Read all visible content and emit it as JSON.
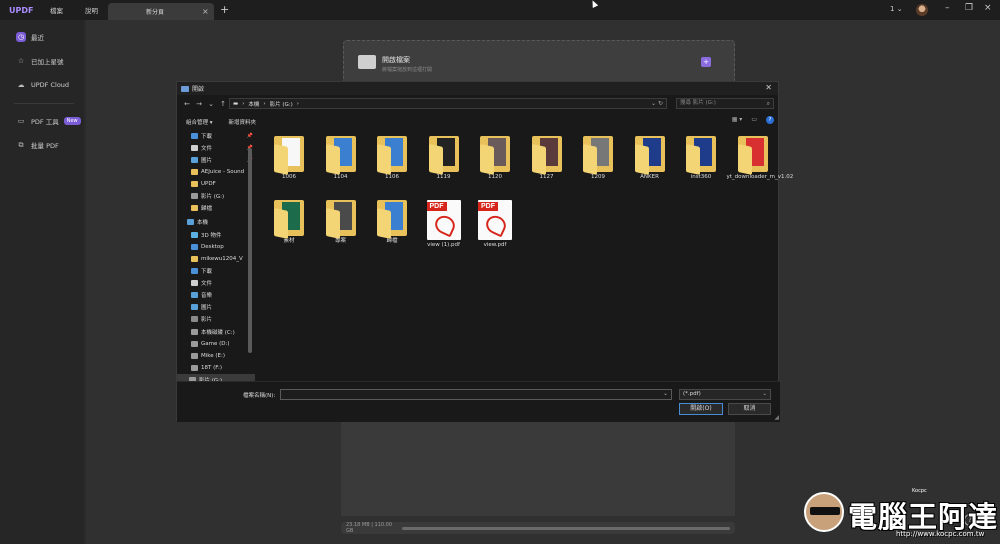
{
  "app": {
    "logo": "UPDF",
    "menu": [
      "檔案",
      "說明"
    ],
    "tab_label": "新分頁",
    "page_selector": "1"
  },
  "sidebar": {
    "items": [
      {
        "label": "最近",
        "icon": "clock-icon"
      },
      {
        "label": "已加上星號",
        "icon": "star-icon"
      },
      {
        "label": "UPDF Cloud",
        "icon": "cloud-icon"
      },
      {
        "label": "PDF 工具",
        "icon": "tools-icon",
        "badge": "New"
      },
      {
        "label": "批量 PDF",
        "icon": "batch-icon"
      }
    ]
  },
  "main": {
    "open_card_title": "開啟檔案",
    "open_card_sub": "將檔案拖放到這裡打開",
    "storage_text": "23.18 MB | 110.00 GB"
  },
  "dialog": {
    "title": "開啟",
    "breadcrumb": [
      "本機",
      "影片 (G:)"
    ],
    "search_placeholder": "搜尋 影片 (G:)",
    "organize": "組合管理",
    "new_folder": "新增資料夾",
    "filename_label": "檔案名稱(N):",
    "filename_value": "",
    "file_type": "(*.pdf)",
    "open_button": "開啟(O)",
    "cancel_button": "取消",
    "tree": [
      {
        "label": "下載",
        "color": "#4a90d9",
        "pin": true
      },
      {
        "label": "文件",
        "color": "#cfcfcf",
        "pin": true
      },
      {
        "label": "圖片",
        "color": "#5aa0d8",
        "pin": true
      },
      {
        "label": "AEJuice - Sound",
        "color": "#e9c15a",
        "pin": false
      },
      {
        "label": "UPDF",
        "color": "#e9c15a",
        "pin": false
      },
      {
        "label": "影片 (G:)",
        "color": "#9a9a9a",
        "pin": false
      },
      {
        "label": "歸檔",
        "color": "#e9c15a",
        "pin": false
      },
      {
        "label": "本機",
        "color": "#5aa0d8",
        "pin": false
      },
      {
        "label": "3D 物件",
        "color": "#5ab0e0",
        "pin": false
      },
      {
        "label": "Desktop",
        "color": "#4a90d9",
        "pin": false
      },
      {
        "label": "mikewu1204_V",
        "color": "#e9c15a",
        "pin": false
      },
      {
        "label": "下載",
        "color": "#4a90d9",
        "pin": false
      },
      {
        "label": "文件",
        "color": "#cfcfcf",
        "pin": false
      },
      {
        "label": "音樂",
        "color": "#5aa0d8",
        "pin": false
      },
      {
        "label": "圖片",
        "color": "#5aa0d8",
        "pin": false
      },
      {
        "label": "影片",
        "color": "#8a8a8a",
        "pin": false
      },
      {
        "label": "本機磁碟 (C:)",
        "color": "#9a9a9a",
        "pin": false
      },
      {
        "label": "Game (D:)",
        "color": "#9a9a9a",
        "pin": false
      },
      {
        "label": "Mike (E:)",
        "color": "#9a9a9a",
        "pin": false
      },
      {
        "label": "18T (F:)",
        "color": "#9a9a9a",
        "pin": false
      },
      {
        "label": "影片 (G:)",
        "color": "#9a9a9a",
        "pin": false
      }
    ],
    "files": [
      {
        "name": "1006",
        "type": "folder",
        "thumb": "#f7f7f7"
      },
      {
        "name": "1104",
        "type": "folder",
        "thumb": "#3a7fd0"
      },
      {
        "name": "1106",
        "type": "folder",
        "thumb": "#3a7fd0"
      },
      {
        "name": "1119",
        "type": "folder",
        "thumb": "#222222"
      },
      {
        "name": "1120",
        "type": "folder",
        "thumb": "#6b5a5a"
      },
      {
        "name": "1127",
        "type": "folder",
        "thumb": "#5a3a3a"
      },
      {
        "name": "1209",
        "type": "folder",
        "thumb": "#777777"
      },
      {
        "name": "ANKER",
        "type": "folder",
        "thumb": "#1e3c8a"
      },
      {
        "name": "inst360",
        "type": "folder",
        "thumb": "#1e3c8a"
      },
      {
        "name": "yt_downloader_m_v1.02",
        "type": "folder",
        "thumb": "#d83030"
      },
      {
        "name": "素材",
        "type": "folder",
        "thumb": "#1c6b4a"
      },
      {
        "name": "專案",
        "type": "folder",
        "thumb": "#4a4a4a"
      },
      {
        "name": "歸檔",
        "type": "folder",
        "thumb": "#3a7fd0"
      },
      {
        "name": "view (1).pdf",
        "type": "pdf",
        "thumb": "#d6261c"
      },
      {
        "name": "view.pdf",
        "type": "pdf",
        "thumb": "#d6261c"
      }
    ]
  },
  "watermark": {
    "title": "電腦王阿達",
    "url": "http://www.kocpc.com.tw",
    "small": "Kocpc"
  }
}
